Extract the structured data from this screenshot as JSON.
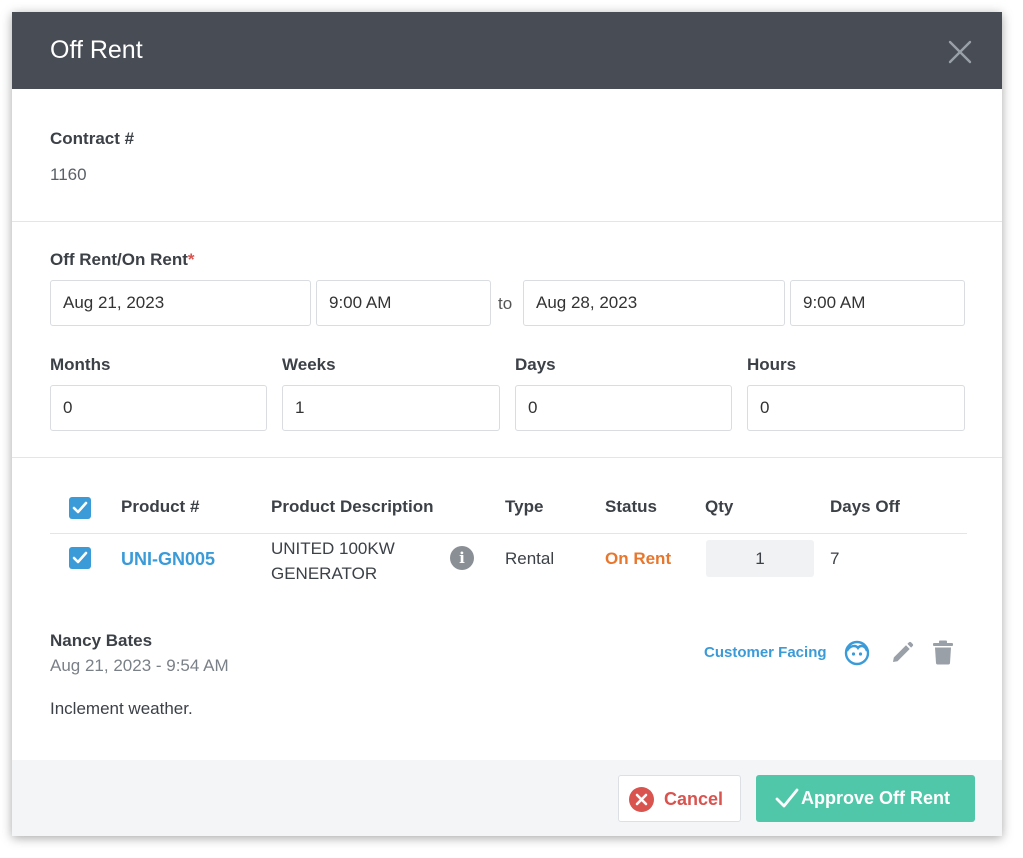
{
  "header": {
    "title": "Off Rent"
  },
  "contract": {
    "label": "Contract #",
    "value": "1160"
  },
  "rent_period": {
    "label": "Off Rent/On Rent",
    "required_mark": "*",
    "start_date": "Aug 21, 2023",
    "start_time": "9:00 AM",
    "separator": "to",
    "end_date": "Aug 28, 2023",
    "end_time": "9:00 AM"
  },
  "duration": {
    "months_label": "Months",
    "months": "0",
    "weeks_label": "Weeks",
    "weeks": "1",
    "days_label": "Days",
    "days": "0",
    "hours_label": "Hours",
    "hours": "0"
  },
  "table": {
    "columns": [
      "Product #",
      "Product Description",
      "Type",
      "Status",
      "Qty",
      "Days Off"
    ],
    "rows": [
      {
        "checked": true,
        "product_no": "UNI-GN005",
        "description": "UNITED 100KW GENERATOR",
        "type": "Rental",
        "status": "On Rent",
        "qty": "1",
        "days_off": "7"
      }
    ]
  },
  "note": {
    "author": "Nancy Bates",
    "timestamp": "Aug 21, 2023 - 9:54 AM",
    "body": "Inclement weather.",
    "visibility": "Customer Facing"
  },
  "footer": {
    "cancel_label": "Cancel",
    "approve_label": "Approve Off Rent"
  },
  "colors": {
    "header_bg": "#484c54",
    "accent": "#3a9bd8",
    "status": "#e8772e",
    "danger": "#d9534f",
    "approve": "#4fc7a8"
  },
  "icons": [
    "close-icon",
    "checkbox-checked-icon",
    "info-icon",
    "face-icon",
    "pencil-icon",
    "trash-icon",
    "cancel-x-icon",
    "checkmark-icon"
  ]
}
